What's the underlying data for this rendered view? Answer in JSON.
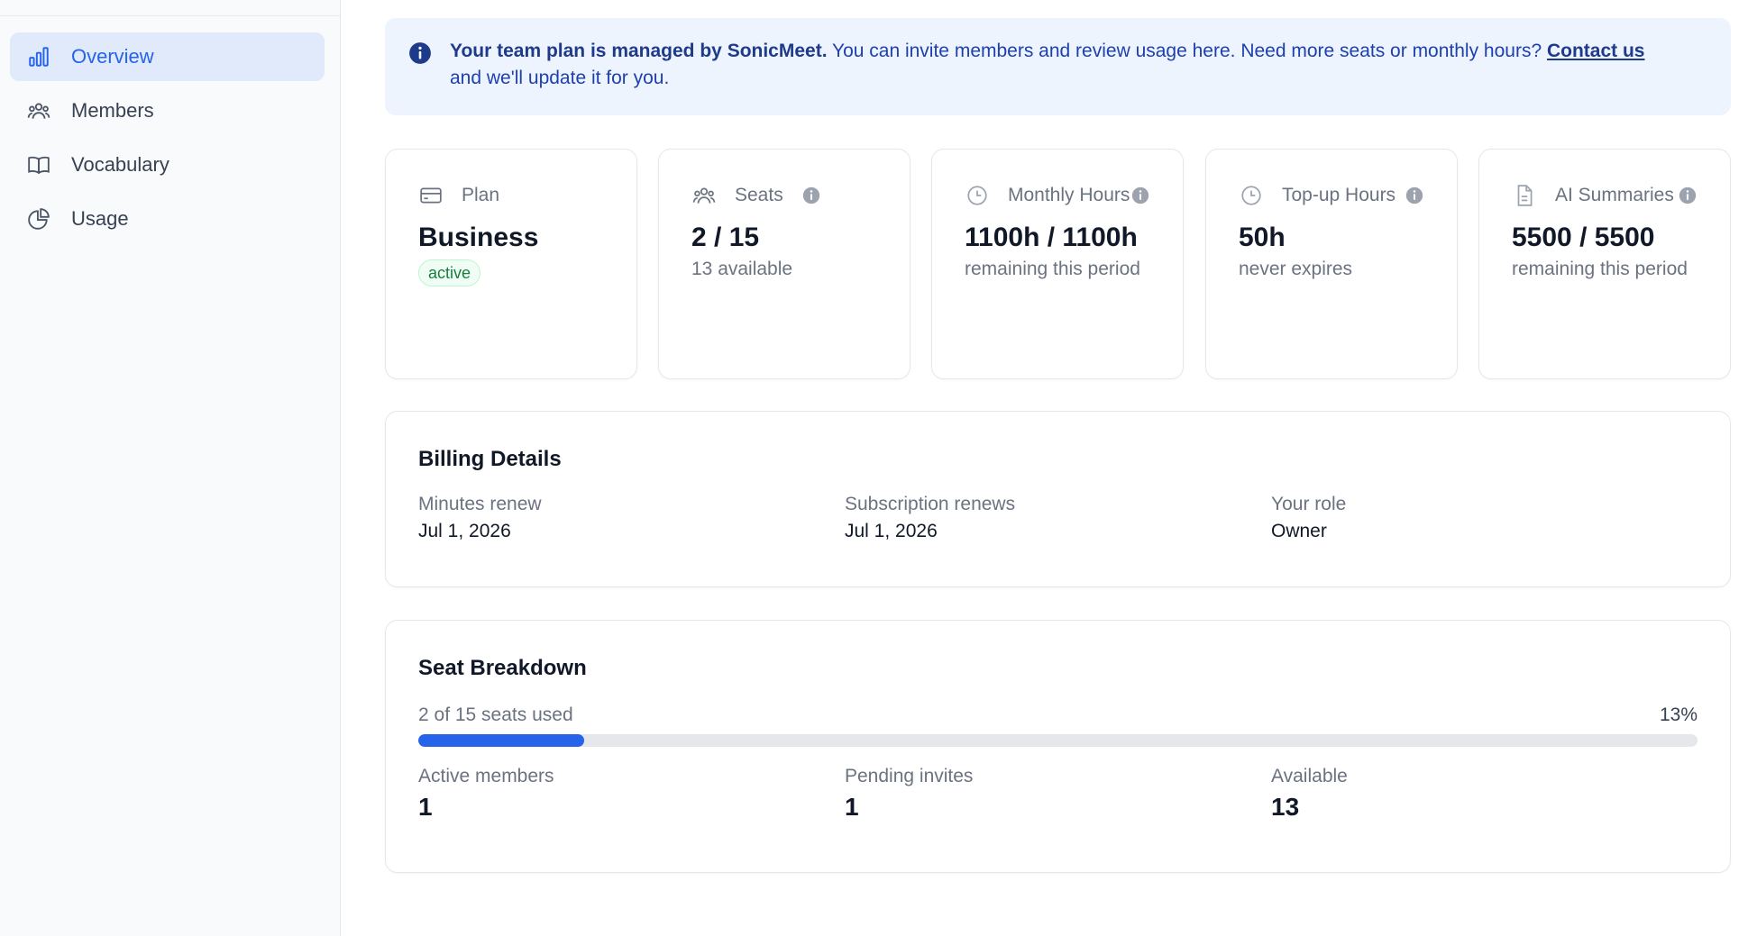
{
  "sidebar": {
    "items": [
      {
        "label": "Overview",
        "icon": "bar-chart-icon",
        "active": true
      },
      {
        "label": "Members",
        "icon": "users-icon",
        "active": false
      },
      {
        "label": "Vocabulary",
        "icon": "book-icon",
        "active": false
      },
      {
        "label": "Usage",
        "icon": "pie-chart-icon",
        "active": false
      }
    ]
  },
  "banner": {
    "strong": "Your team plan is managed by SonicMeet.",
    "text": " You can invite members and review usage here. Need more seats or monthly hours? ",
    "link": "Contact us",
    "tail": "and we'll update it for you."
  },
  "cards": {
    "plan": {
      "title": "Plan",
      "value": "Business",
      "badge": "active"
    },
    "seats": {
      "title": "Seats",
      "value": "2 / 15",
      "sub": "13 available"
    },
    "monthly": {
      "title": "Monthly Hours",
      "value": "1100h / 1100h",
      "sub": "remaining this period"
    },
    "topup": {
      "title": "Top-up Hours",
      "value": "50h",
      "sub": "never expires"
    },
    "ai": {
      "title": "AI Summaries",
      "value": "5500 / 5500",
      "sub": "remaining this period"
    }
  },
  "billing": {
    "title": "Billing Details",
    "minutes_label": "Minutes renew",
    "minutes_value": "Jul 1, 2026",
    "subscription_label": "Subscription renews",
    "subscription_value": "Jul 1, 2026",
    "role_label": "Your role",
    "role_value": "Owner"
  },
  "seat_breakdown": {
    "title": "Seat Breakdown",
    "used_text": "2 of 15 seats used",
    "percent_text": "13%",
    "percent_value": 13,
    "active_label": "Active members",
    "active_value": "1",
    "pending_label": "Pending invites",
    "pending_value": "1",
    "available_label": "Available",
    "available_value": "13"
  },
  "colors": {
    "accent": "#2563eb",
    "banner_bg": "#eef4fe",
    "active_badge": "#15803d"
  }
}
